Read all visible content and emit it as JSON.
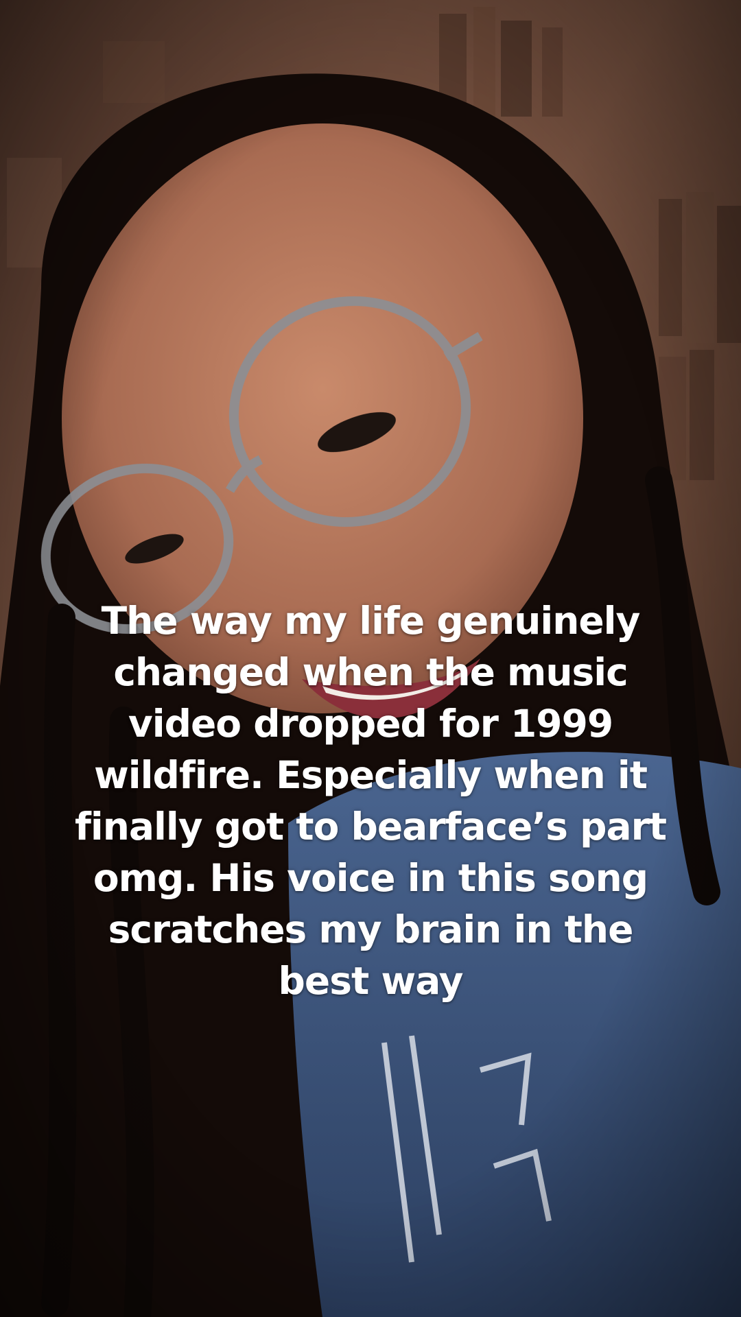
{
  "caption": {
    "text": "The way my life genuinely changed when the music video dropped for 1999 wildfire. Especially when it finally got to bearface’s part omg. His voice in this song scratches my brain in the best way"
  },
  "photo": {
    "subject": "selfie-smiling-person-with-glasses",
    "colors": {
      "background_warm": "#6e4a39",
      "hair": "#120a08",
      "skin": "#b97a5e",
      "hoodie": "#3f5a86",
      "glasses_frame": "#8c8f95"
    }
  }
}
